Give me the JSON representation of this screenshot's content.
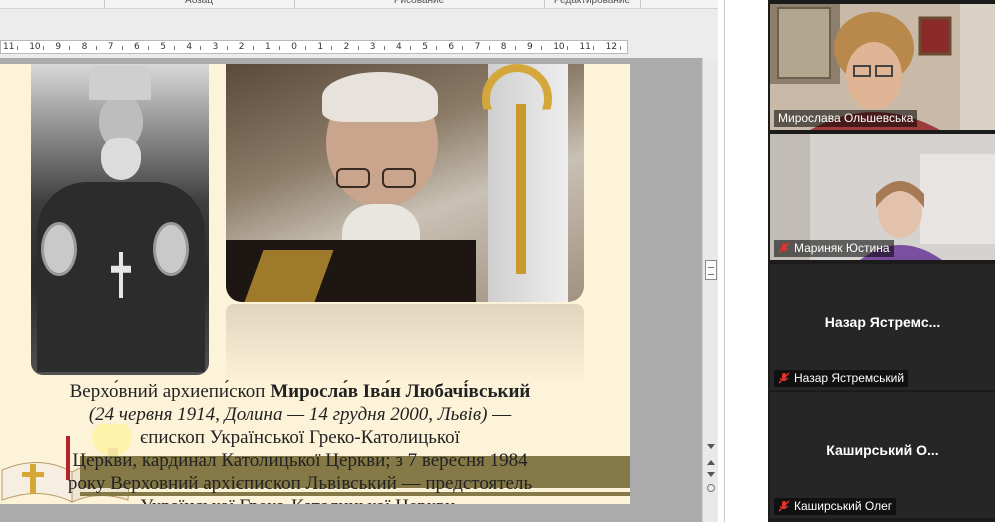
{
  "ribbon": {
    "groups": [
      "Абзац",
      "Рисование",
      "Редактирование"
    ]
  },
  "ruler": {
    "labels": [
      "11",
      "10",
      "9",
      "8",
      "7",
      "6",
      "5",
      "4",
      "3",
      "2",
      "1",
      "0",
      "1",
      "2",
      "3",
      "4",
      "5",
      "6",
      "7",
      "8",
      "9",
      "10",
      "11",
      "12"
    ]
  },
  "document": {
    "caption": {
      "line1_prefix": "Верхо́вний архиепи́скоп ",
      "line1_bold": "Миросла́в Іва́н Любачі́вський",
      "line2_italic": "(24 червня 1914, Долина — 14 грудня 2000, Львів)",
      "line2_suffix": " —",
      "line3": "єпископ Української Греко-Католицької",
      "line4": "Церкви, кардинал Католицької Церкви; з 7 вересня 1984",
      "line5": "року Верховний архієпископ Львівський — предстоятель",
      "line6": "Української Греко-Католицької Церкви."
    }
  },
  "video": {
    "participants": [
      {
        "label": "Мирослава Ольшевська",
        "muted": false,
        "has_video": true
      },
      {
        "label": "Мариняк Юстина",
        "muted": true,
        "has_video": true
      },
      {
        "tile_name": "Назар Ястремс...",
        "label": "Назар Ястремський",
        "muted": true,
        "has_video": false
      },
      {
        "tile_name": "Каширський О...",
        "label": "Каширський Олег",
        "muted": true,
        "has_video": false
      }
    ],
    "colors": {
      "active_border": "#9ad05f",
      "mute_icon": "#e0322b"
    }
  }
}
